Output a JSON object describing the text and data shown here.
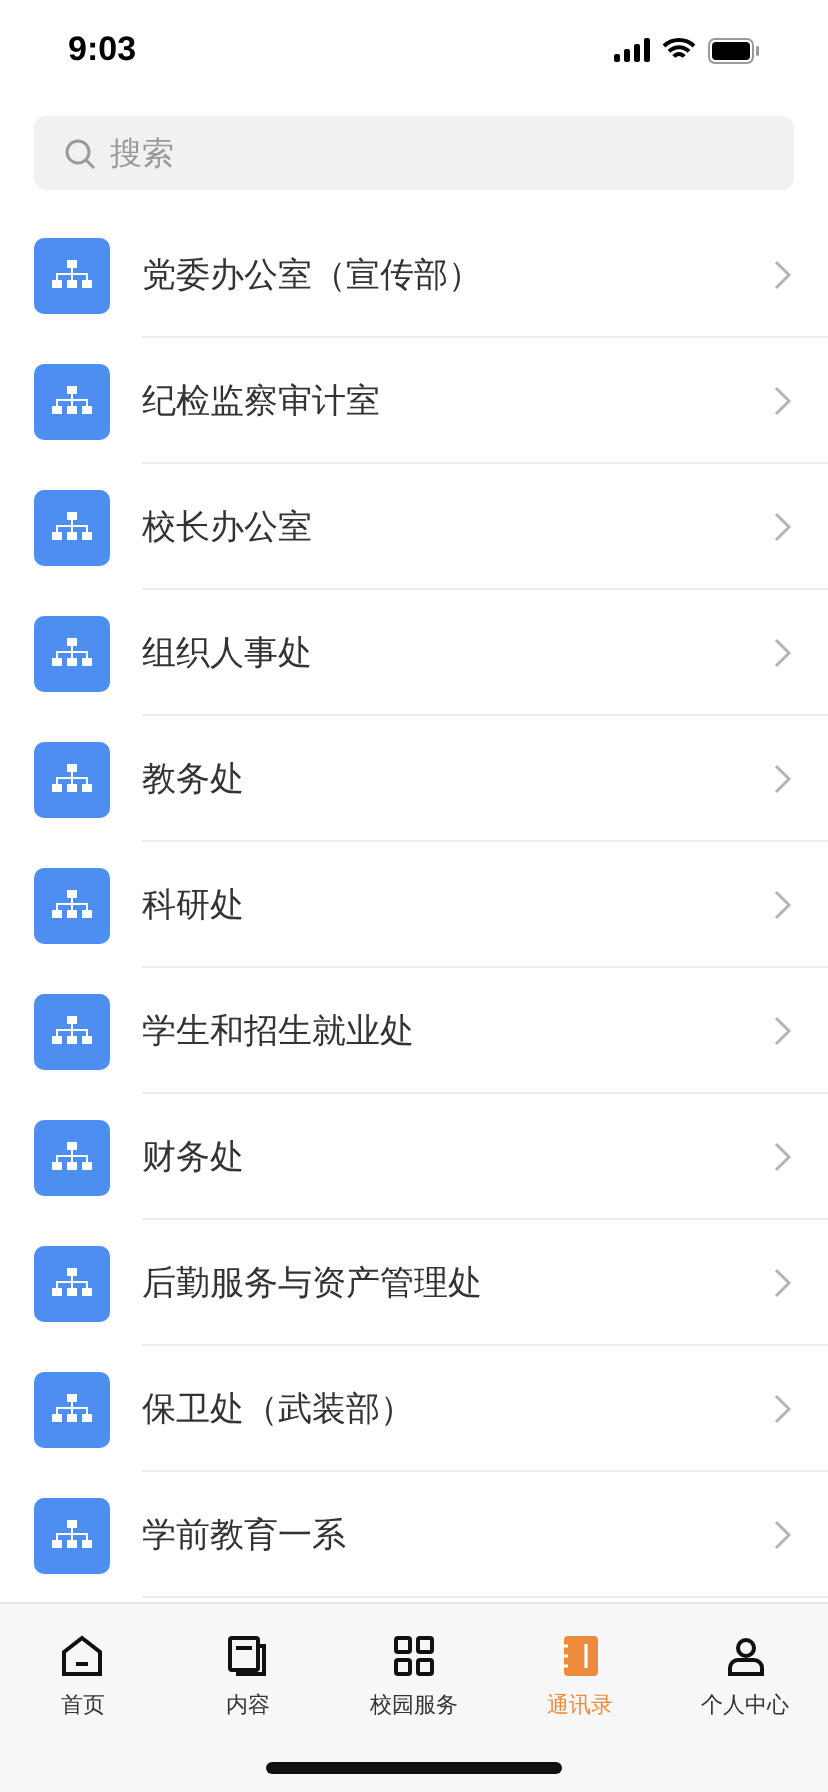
{
  "status_bar": {
    "time": "9:03"
  },
  "search": {
    "placeholder": "搜索"
  },
  "departments": [
    {
      "name": "党委办公室（宣传部）"
    },
    {
      "name": "纪检监察审计室"
    },
    {
      "name": "校长办公室"
    },
    {
      "name": "组织人事处"
    },
    {
      "name": "教务处"
    },
    {
      "name": "科研处"
    },
    {
      "name": "学生和招生就业处"
    },
    {
      "name": "财务处"
    },
    {
      "name": "后勤服务与资产管理处"
    },
    {
      "name": "保卫处（武装部）"
    },
    {
      "name": "学前教育一系"
    }
  ],
  "tab_bar": [
    {
      "kind": "home",
      "label": "首页",
      "selected": false
    },
    {
      "kind": "content",
      "label": "内容",
      "selected": false
    },
    {
      "kind": "services",
      "label": "校园服务",
      "selected": false
    },
    {
      "kind": "contacts",
      "label": "通讯录",
      "selected": true
    },
    {
      "kind": "profile",
      "label": "个人中心",
      "selected": false
    }
  ]
}
